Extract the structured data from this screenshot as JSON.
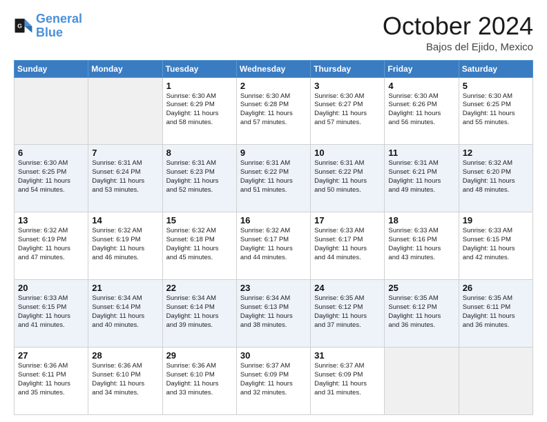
{
  "logo": {
    "line1": "General",
    "line2": "Blue"
  },
  "title": "October 2024",
  "location": "Bajos del Ejido, Mexico",
  "days_of_week": [
    "Sunday",
    "Monday",
    "Tuesday",
    "Wednesday",
    "Thursday",
    "Friday",
    "Saturday"
  ],
  "weeks": [
    [
      {
        "day": "",
        "info": ""
      },
      {
        "day": "",
        "info": ""
      },
      {
        "day": "1",
        "info": "Sunrise: 6:30 AM\nSunset: 6:29 PM\nDaylight: 11 hours\nand 58 minutes."
      },
      {
        "day": "2",
        "info": "Sunrise: 6:30 AM\nSunset: 6:28 PM\nDaylight: 11 hours\nand 57 minutes."
      },
      {
        "day": "3",
        "info": "Sunrise: 6:30 AM\nSunset: 6:27 PM\nDaylight: 11 hours\nand 57 minutes."
      },
      {
        "day": "4",
        "info": "Sunrise: 6:30 AM\nSunset: 6:26 PM\nDaylight: 11 hours\nand 56 minutes."
      },
      {
        "day": "5",
        "info": "Sunrise: 6:30 AM\nSunset: 6:25 PM\nDaylight: 11 hours\nand 55 minutes."
      }
    ],
    [
      {
        "day": "6",
        "info": "Sunrise: 6:30 AM\nSunset: 6:25 PM\nDaylight: 11 hours\nand 54 minutes."
      },
      {
        "day": "7",
        "info": "Sunrise: 6:31 AM\nSunset: 6:24 PM\nDaylight: 11 hours\nand 53 minutes."
      },
      {
        "day": "8",
        "info": "Sunrise: 6:31 AM\nSunset: 6:23 PM\nDaylight: 11 hours\nand 52 minutes."
      },
      {
        "day": "9",
        "info": "Sunrise: 6:31 AM\nSunset: 6:22 PM\nDaylight: 11 hours\nand 51 minutes."
      },
      {
        "day": "10",
        "info": "Sunrise: 6:31 AM\nSunset: 6:22 PM\nDaylight: 11 hours\nand 50 minutes."
      },
      {
        "day": "11",
        "info": "Sunrise: 6:31 AM\nSunset: 6:21 PM\nDaylight: 11 hours\nand 49 minutes."
      },
      {
        "day": "12",
        "info": "Sunrise: 6:32 AM\nSunset: 6:20 PM\nDaylight: 11 hours\nand 48 minutes."
      }
    ],
    [
      {
        "day": "13",
        "info": "Sunrise: 6:32 AM\nSunset: 6:19 PM\nDaylight: 11 hours\nand 47 minutes."
      },
      {
        "day": "14",
        "info": "Sunrise: 6:32 AM\nSunset: 6:19 PM\nDaylight: 11 hours\nand 46 minutes."
      },
      {
        "day": "15",
        "info": "Sunrise: 6:32 AM\nSunset: 6:18 PM\nDaylight: 11 hours\nand 45 minutes."
      },
      {
        "day": "16",
        "info": "Sunrise: 6:32 AM\nSunset: 6:17 PM\nDaylight: 11 hours\nand 44 minutes."
      },
      {
        "day": "17",
        "info": "Sunrise: 6:33 AM\nSunset: 6:17 PM\nDaylight: 11 hours\nand 44 minutes."
      },
      {
        "day": "18",
        "info": "Sunrise: 6:33 AM\nSunset: 6:16 PM\nDaylight: 11 hours\nand 43 minutes."
      },
      {
        "day": "19",
        "info": "Sunrise: 6:33 AM\nSunset: 6:15 PM\nDaylight: 11 hours\nand 42 minutes."
      }
    ],
    [
      {
        "day": "20",
        "info": "Sunrise: 6:33 AM\nSunset: 6:15 PM\nDaylight: 11 hours\nand 41 minutes."
      },
      {
        "day": "21",
        "info": "Sunrise: 6:34 AM\nSunset: 6:14 PM\nDaylight: 11 hours\nand 40 minutes."
      },
      {
        "day": "22",
        "info": "Sunrise: 6:34 AM\nSunset: 6:14 PM\nDaylight: 11 hours\nand 39 minutes."
      },
      {
        "day": "23",
        "info": "Sunrise: 6:34 AM\nSunset: 6:13 PM\nDaylight: 11 hours\nand 38 minutes."
      },
      {
        "day": "24",
        "info": "Sunrise: 6:35 AM\nSunset: 6:12 PM\nDaylight: 11 hours\nand 37 minutes."
      },
      {
        "day": "25",
        "info": "Sunrise: 6:35 AM\nSunset: 6:12 PM\nDaylight: 11 hours\nand 36 minutes."
      },
      {
        "day": "26",
        "info": "Sunrise: 6:35 AM\nSunset: 6:11 PM\nDaylight: 11 hours\nand 36 minutes."
      }
    ],
    [
      {
        "day": "27",
        "info": "Sunrise: 6:36 AM\nSunset: 6:11 PM\nDaylight: 11 hours\nand 35 minutes."
      },
      {
        "day": "28",
        "info": "Sunrise: 6:36 AM\nSunset: 6:10 PM\nDaylight: 11 hours\nand 34 minutes."
      },
      {
        "day": "29",
        "info": "Sunrise: 6:36 AM\nSunset: 6:10 PM\nDaylight: 11 hours\nand 33 minutes."
      },
      {
        "day": "30",
        "info": "Sunrise: 6:37 AM\nSunset: 6:09 PM\nDaylight: 11 hours\nand 32 minutes."
      },
      {
        "day": "31",
        "info": "Sunrise: 6:37 AM\nSunset: 6:09 PM\nDaylight: 11 hours\nand 31 minutes."
      },
      {
        "day": "",
        "info": ""
      },
      {
        "day": "",
        "info": ""
      }
    ]
  ],
  "row_colors": [
    "#ffffff",
    "#eef3fa",
    "#ffffff",
    "#eef3fa",
    "#ffffff"
  ]
}
